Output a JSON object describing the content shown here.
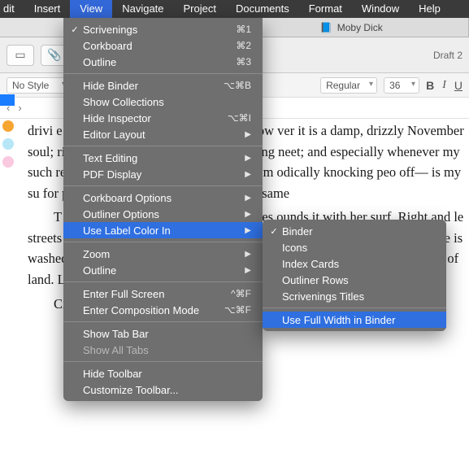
{
  "menubar": {
    "items": [
      "dit",
      "Insert",
      "View",
      "Navigate",
      "Project",
      "Documents",
      "Format",
      "Window",
      "Help"
    ],
    "active_index": 2
  },
  "tabs": {
    "left": "",
    "right_icon": "book-icon",
    "right_label": "Moby Dick"
  },
  "breadcrumb": "Draft 2",
  "formatbar": {
    "style": "No Style",
    "weight": "Regular",
    "size": "36",
    "b": "B",
    "i": "I",
    "u": "U"
  },
  "nav": {
    "back": "‹",
    "forward": "›"
  },
  "dots": [
    "#f6a531",
    "#b7e7f7",
    "#f9c9df"
  ],
  "editor": {
    "p1": "drivi                                                                      e circulation. Whenever I find mys  grow                                                                    ver it is a damp, drizzly November  soul;                                                                     rily pausing before coffin warehou  bring                                                                    neet; and especially whenever my  such                                                                     res a strong moral principle to prev from                                                                                          odically knocking peo off—                                                                                            is my su for p                                                                                                     elf upor swor                                                                                                  . If they knew                                                                                                 very n same",
    "p2": "T                                                               d round the middle by wharves as  isles                                                               ounds it with her surf. Right and le streets take you water-ward. Its extreme downtown is the battery, where t mole is washed by waves, and cooled by breezes, which a few hours prev out of sight of land. Look at the crowds of water-gazers there.",
    "p3": "Circumambulate this city during a dreamy Sabbath afternoon. Go from"
  },
  "menu": {
    "groups": [
      [
        {
          "label": "Scrivenings",
          "accel": "⌘1",
          "check": true
        },
        {
          "label": "Corkboard",
          "accel": "⌘2"
        },
        {
          "label": "Outline",
          "accel": "⌘3"
        }
      ],
      [
        {
          "label": "Hide Binder",
          "accel": "⌥⌘B"
        },
        {
          "label": "Show Collections"
        },
        {
          "label": "Hide Inspector",
          "accel": "⌥⌘I"
        },
        {
          "label": "Editor Layout",
          "submenu": true
        }
      ],
      [
        {
          "label": "Text Editing",
          "submenu": true
        },
        {
          "label": "PDF Display",
          "submenu": true
        }
      ],
      [
        {
          "label": "Corkboard Options",
          "submenu": true
        },
        {
          "label": "Outliner Options",
          "submenu": true
        },
        {
          "label": "Use Label Color In",
          "submenu": true,
          "highlight": true
        }
      ],
      [
        {
          "label": "Zoom",
          "submenu": true
        },
        {
          "label": "Outline",
          "submenu": true
        }
      ],
      [
        {
          "label": "Enter Full Screen",
          "accel": "^⌘F"
        },
        {
          "label": "Enter Composition Mode",
          "accel": "⌥⌘F"
        }
      ],
      [
        {
          "label": "Show Tab Bar"
        },
        {
          "label": "Show All Tabs",
          "disabled": true
        }
      ],
      [
        {
          "label": "Hide Toolbar"
        },
        {
          "label": "Customize Toolbar..."
        }
      ]
    ]
  },
  "submenu": {
    "items": [
      {
        "label": "Binder",
        "check": true
      },
      {
        "label": "Icons"
      },
      {
        "label": "Index Cards"
      },
      {
        "label": "Outliner Rows"
      },
      {
        "label": "Scrivenings Titles"
      }
    ],
    "footer": {
      "label": "Use Full Width in Binder",
      "highlight": true
    }
  }
}
